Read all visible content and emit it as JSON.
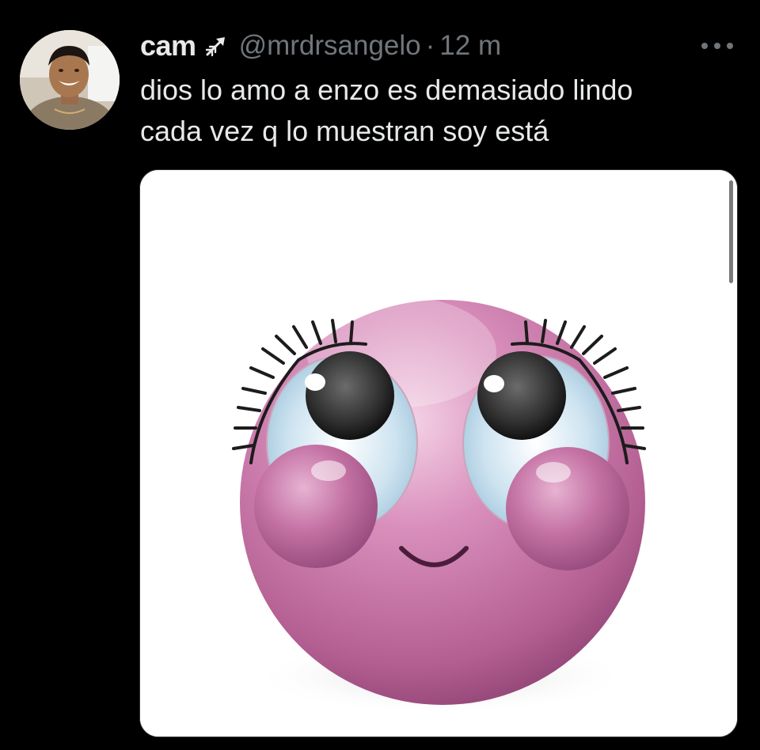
{
  "tweet": {
    "display_name": "cam",
    "name_icon": "arrow-icon",
    "handle": "@mrdrsangelo",
    "separator": "·",
    "time": "12 m",
    "text_lines": [
      "dios lo amo a enzo es demasiado lindo",
      "cada vez q lo muestran soy está"
    ],
    "more_icon": "more-options-icon",
    "media": {
      "subject": "pink-blushing-smiley-emoji",
      "background": "#ffffff"
    }
  },
  "colors": {
    "background": "#000000",
    "primary_text": "#e7e9ea",
    "secondary_text": "#71767b",
    "emoji_pink": "#c8699f"
  }
}
